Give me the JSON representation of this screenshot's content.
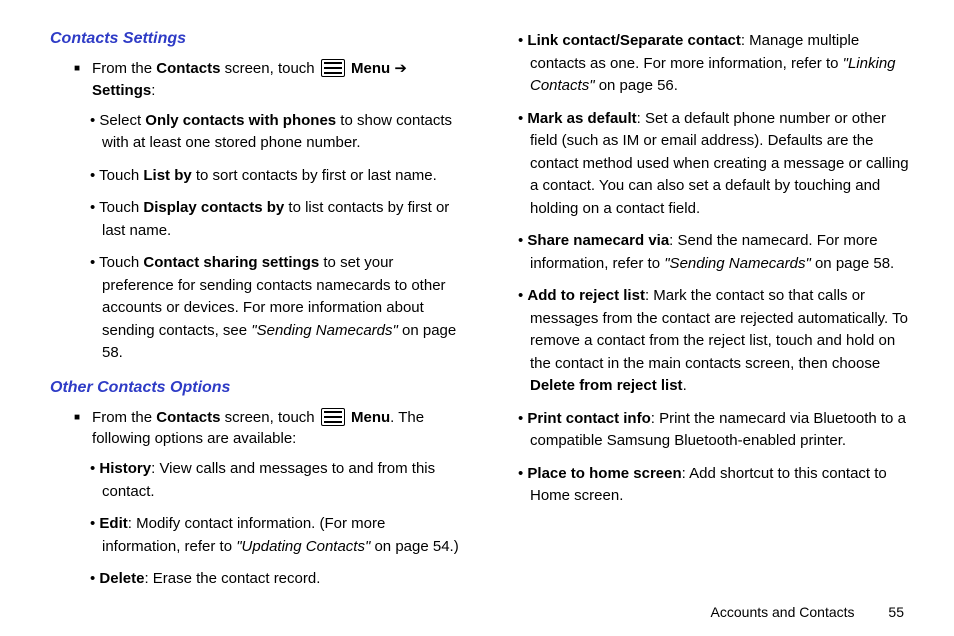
{
  "sections": {
    "contacts_settings_title": "Contacts Settings",
    "other_options_title": "Other Contacts Options"
  },
  "intro1": {
    "pre": "From the ",
    "contacts": "Contacts",
    "mid": " screen, touch ",
    "menu": "Menu",
    "arrow": " ➔ ",
    "settings": "Settings",
    "end": ":"
  },
  "settings_list": {
    "li1": {
      "pre": "Select ",
      "b": "Only contacts with phones",
      "post": " to show contacts with at least one stored phone number."
    },
    "li2": {
      "pre": "Touch ",
      "b": "List by",
      "post": " to sort contacts by first or last name."
    },
    "li3": {
      "pre": "Touch ",
      "b": "Display contacts by",
      "post": " to list contacts by first or last name."
    },
    "li4": {
      "pre": "Touch ",
      "b": "Contact sharing settings",
      "post1": " to set your preference for sending contacts namecards to other accounts or devices. For more information about sending contacts, see ",
      "ref": "\"Sending Namecards\"",
      "post2": " on page 58."
    }
  },
  "intro2": {
    "pre": "From the ",
    "contacts": "Contacts",
    "mid": " screen, touch ",
    "menu": "Menu",
    "post": ". The following options are available:"
  },
  "options": {
    "history": {
      "b": "History",
      "t": ": View calls and messages to and from this contact."
    },
    "edit": {
      "b": "Edit",
      "t1": ": Modify contact information. (For more information, refer to ",
      "ref": "\"Updating Contacts\"",
      "t2": " on page 54.)"
    },
    "delete": {
      "b": "Delete",
      "t": ": Erase the contact record."
    },
    "link": {
      "b": "Link contact/Separate contact",
      "t1": ": Manage multiple contacts as one. For more information, refer to ",
      "ref": "\"Linking Contacts\"",
      "t2": " on page 56."
    },
    "mark": {
      "b": "Mark as default",
      "t": ": Set a default phone number or other field (such as IM or email address). Defaults are the contact method used when creating a message or calling a contact. You can also set a default by touching and holding on a contact field."
    },
    "share": {
      "b": "Share namecard via",
      "t1": ": Send the namecard. For more information, refer to ",
      "ref": "\"Sending Namecards\"",
      "t2": " on page 58."
    },
    "reject": {
      "b": "Add to reject list",
      "t1": ": Mark the contact so that calls or messages from the contact are rejected automatically. To remove a contact from the reject list, touch and hold on the contact in the main contacts screen, then choose ",
      "b2": "Delete from reject list",
      "t2": "."
    },
    "print": {
      "b": "Print contact info",
      "t": ": Print the namecard via Bluetooth to a compatible Samsung Bluetooth-enabled printer."
    },
    "place": {
      "b": "Place to home screen",
      "t": ": Add shortcut to this contact to Home screen."
    }
  },
  "footer": {
    "section": "Accounts and Contacts",
    "page": "55"
  }
}
